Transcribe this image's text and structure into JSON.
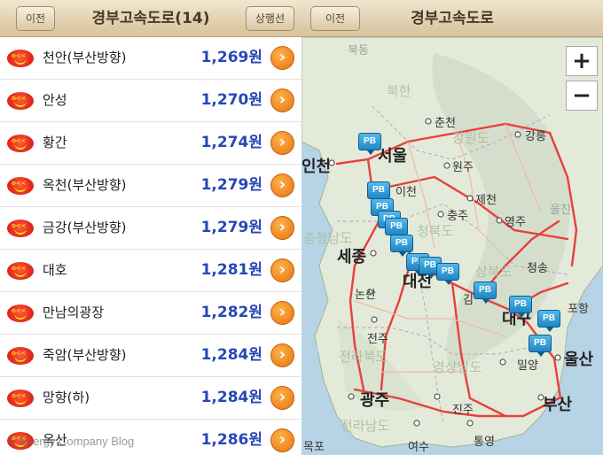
{
  "list_view": {
    "back_label": "이전",
    "title": "경부고속도로(14)",
    "direction_label": "상행선",
    "stations": [
      {
        "name": "천안(부산방향)",
        "price": "1,269원"
      },
      {
        "name": "안성",
        "price": "1,270원"
      },
      {
        "name": "황간",
        "price": "1,274원"
      },
      {
        "name": "옥천(부산방향)",
        "price": "1,279원"
      },
      {
        "name": "금강(부산방향)",
        "price": "1,279원"
      },
      {
        "name": "대호",
        "price": "1,281원"
      },
      {
        "name": "만남의광장",
        "price": "1,282원"
      },
      {
        "name": "죽암(부산방향)",
        "price": "1,284원"
      },
      {
        "name": "망향(하)",
        "price": "1,284원"
      },
      {
        "name": "옥산",
        "price": "1,286원"
      }
    ],
    "brand_icon": "gs-caltex-smile-logo",
    "chevron_icon": "chevron-right-icon",
    "watermark": "© Energy Company Blog",
    "price_color": "#2747b8"
  },
  "map_view": {
    "back_label": "이전",
    "title": "경부고속도로",
    "zoom_in": "+",
    "zoom_out": "−",
    "marker_label": "PB",
    "marker_count": 14,
    "places": {
      "north_korea": "북한",
      "sea_north": "북동",
      "gangwon": "강원도",
      "chuncheon": "춘천",
      "gangneung": "강릉",
      "seoul": "서울",
      "incheon": "인천",
      "wonju": "원주",
      "icheon": "이천",
      "jecheon": "제천",
      "chungju": "충주",
      "yeongju": "영주",
      "uljin": "울진",
      "chungnam": "충청남도",
      "chungbuk": "청북도",
      "sejong": "세종",
      "nonsan": "논산",
      "daejeon": "대전",
      "gyeongbuk": "상북도",
      "cheongsong": "청송",
      "pohang": "포항",
      "jeonju": "전주",
      "jeonbuk": "전라북도",
      "gyeongnam": "경상남도",
      "daegu": "대구",
      "gimcheon": "김",
      "miryang": "밀양",
      "ulsan": "울산",
      "gwangju": "광주",
      "jinju": "진주",
      "busan": "부산",
      "jeonnam": "전라남도",
      "mokpo": "목포",
      "yeosu": "여수",
      "tongyeong": "통영"
    }
  }
}
